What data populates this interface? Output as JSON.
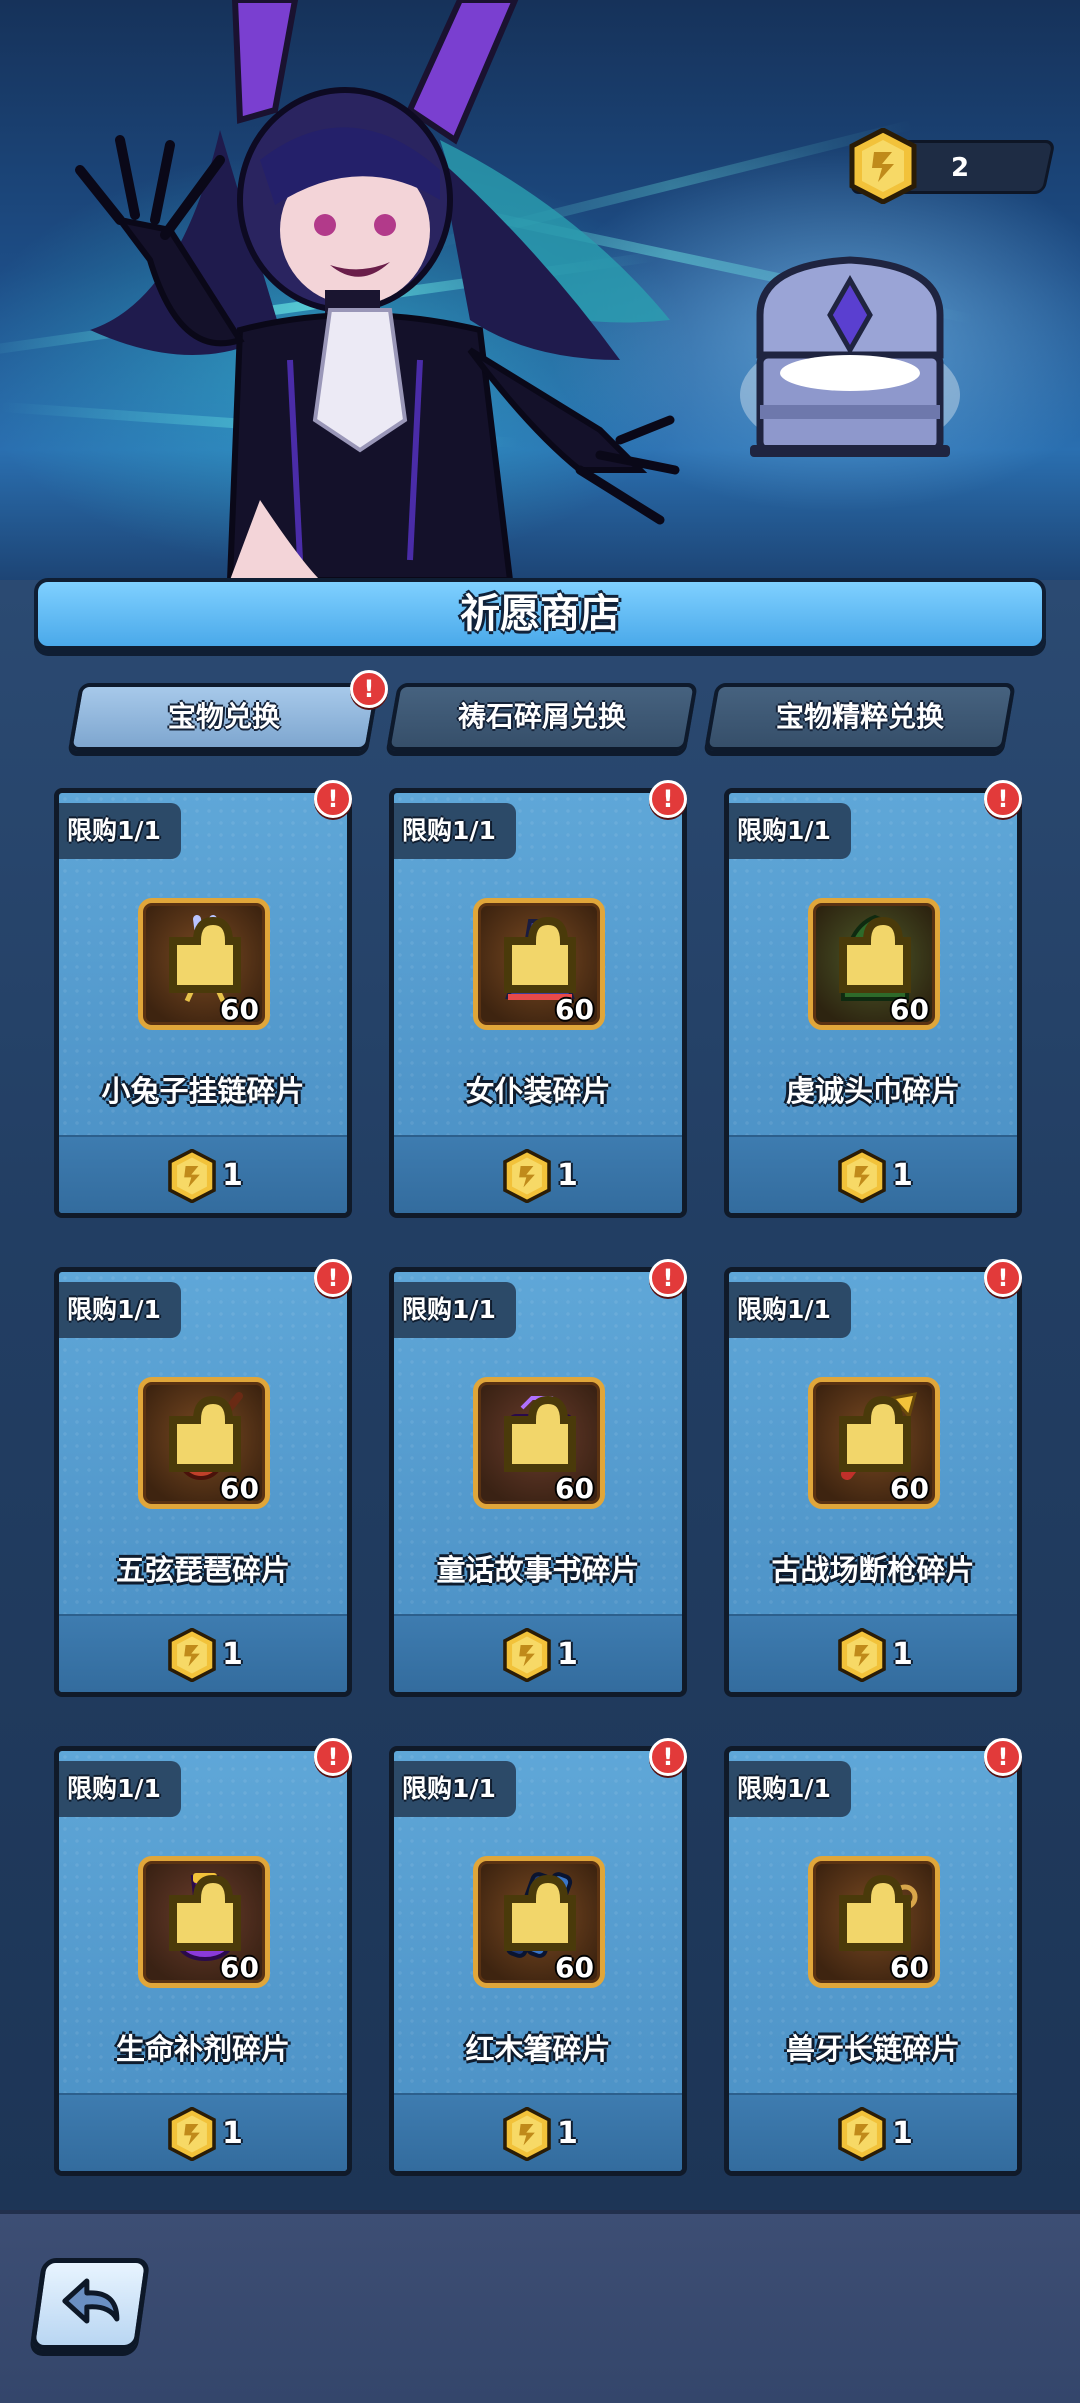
{
  "header": {
    "currency_count": "2"
  },
  "shop": {
    "title": "祈愿商店",
    "tabs": [
      {
        "label": "宝物兑换",
        "active": true,
        "has_alert": true
      },
      {
        "label": "祷石碎屑兑换",
        "active": false,
        "has_alert": false
      },
      {
        "label": "宝物精粹兑换",
        "active": false,
        "has_alert": false
      }
    ],
    "items": [
      {
        "limit": "限购1/1",
        "name": "小兔子挂链碎片",
        "qty": "60",
        "price": "1",
        "icon": "bunny-charm-icon"
      },
      {
        "limit": "限购1/1",
        "name": "女仆装碎片",
        "qty": "60",
        "price": "1",
        "icon": "maid-dress-icon"
      },
      {
        "limit": "限购1/1",
        "name": "虔诚头巾碎片",
        "qty": "60",
        "price": "1",
        "icon": "hood-icon"
      },
      {
        "limit": "限购1/1",
        "name": "五弦琵琶碎片",
        "qty": "60",
        "price": "1",
        "icon": "pipa-lute-icon"
      },
      {
        "limit": "限购1/1",
        "name": "童话故事书碎片",
        "qty": "60",
        "price": "1",
        "icon": "storybook-icon"
      },
      {
        "limit": "限购1/1",
        "name": "古战场断枪碎片",
        "qty": "60",
        "price": "1",
        "icon": "broken-spear-icon"
      },
      {
        "limit": "限购1/1",
        "name": "生命补剂碎片",
        "qty": "60",
        "price": "1",
        "icon": "potion-icon"
      },
      {
        "limit": "限购1/1",
        "name": "红木箸碎片",
        "qty": "60",
        "price": "1",
        "icon": "chopsticks-icon"
      },
      {
        "limit": "限购1/1",
        "name": "兽牙长链碎片",
        "qty": "60",
        "price": "1",
        "icon": "fang-chain-icon"
      }
    ],
    "alert_mark": "!"
  },
  "colors": {
    "accent": "#4aa9ea",
    "card": "#5fa7d8",
    "alert": "#e23a3a",
    "coin": "#f2c23a"
  }
}
